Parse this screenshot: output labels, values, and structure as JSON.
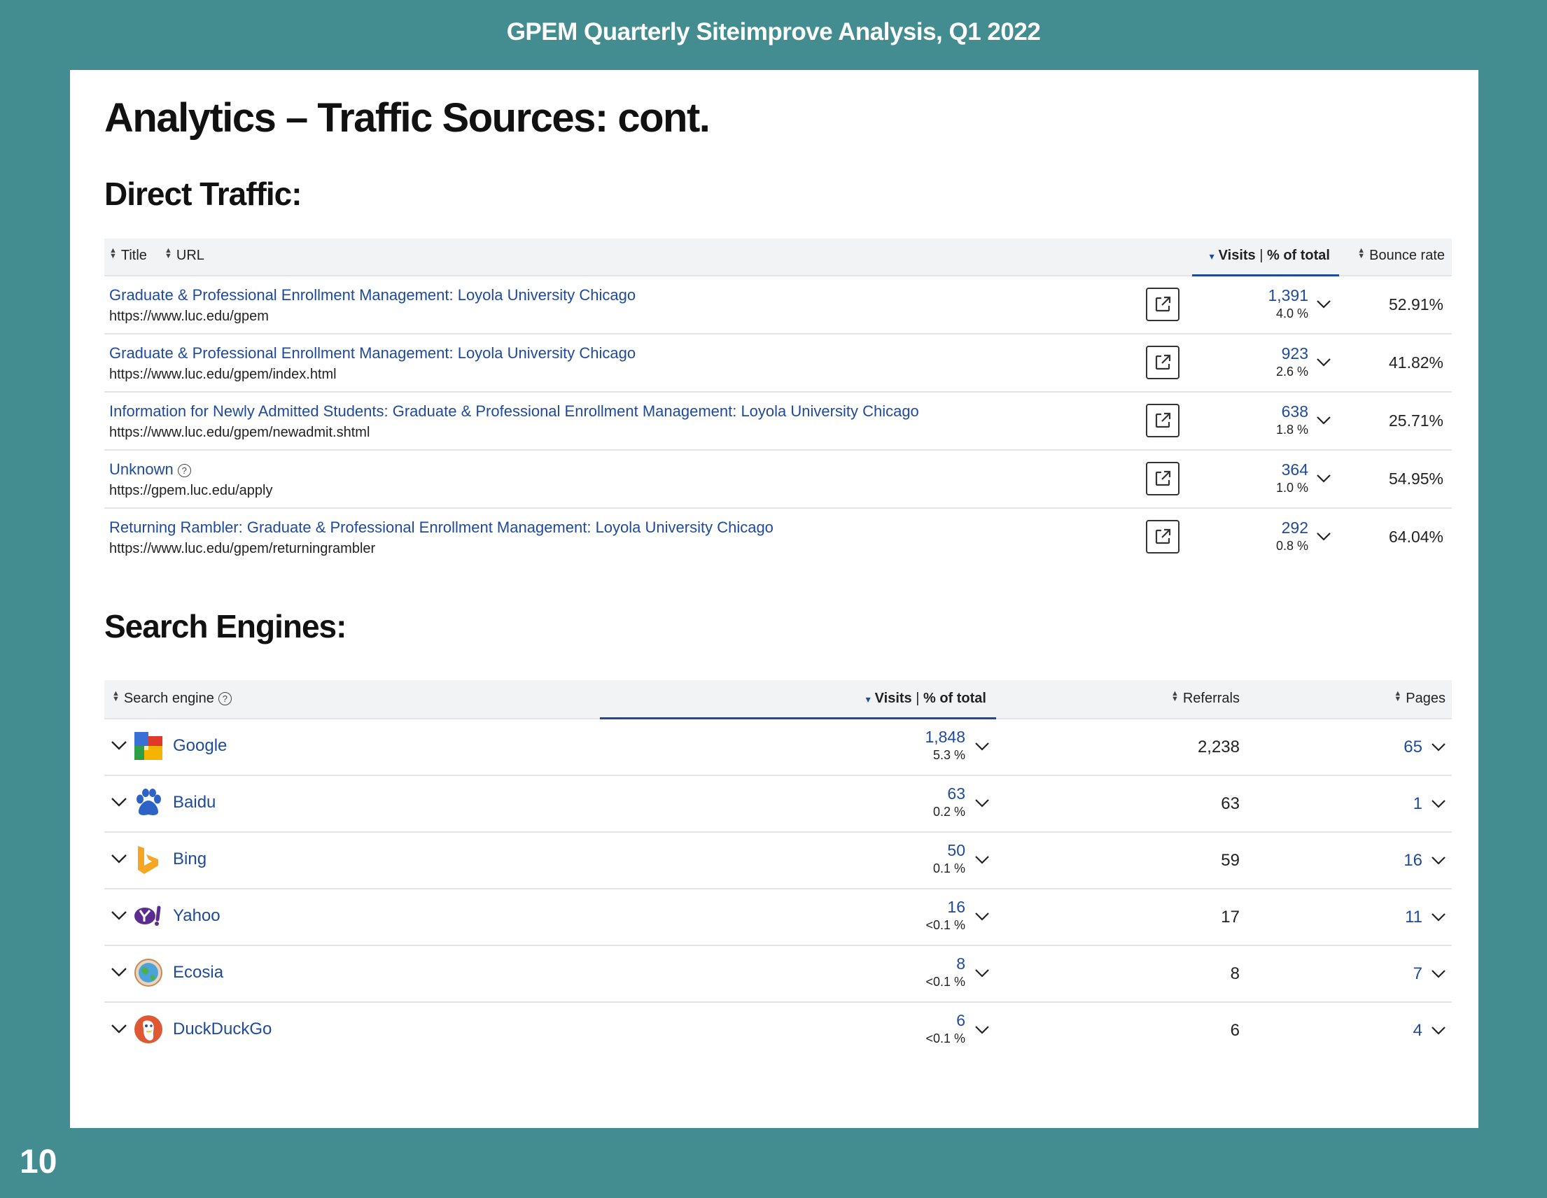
{
  "header": {
    "title": "GPEM Quarterly Siteimprove Analysis, Q1 2022"
  },
  "page": {
    "title": "Analytics – Traffic Sources: cont.",
    "number": "10"
  },
  "direct_traffic": {
    "heading": "Direct Traffic:",
    "columns": {
      "title": "Title",
      "url": "URL",
      "visits": "Visits",
      "separator": "|",
      "pct_total": "% of total",
      "bounce": "Bounce rate"
    },
    "rows": [
      {
        "title": "Graduate & Professional Enrollment Management: Loyola University Chicago",
        "url": "https://www.luc.edu/gpem",
        "visits": "1,391",
        "pct": "4.0 %",
        "bounce": "52.91%"
      },
      {
        "title": "Graduate & Professional Enrollment Management: Loyola University Chicago",
        "url": "https://www.luc.edu/gpem/index.html",
        "visits": "923",
        "pct": "2.6 %",
        "bounce": "41.82%"
      },
      {
        "title": "Information for Newly Admitted Students: Graduate & Professional Enrollment Management: Loyola University Chicago",
        "url": "https://www.luc.edu/gpem/newadmit.shtml",
        "visits": "638",
        "pct": "1.8 %",
        "bounce": "25.71%"
      },
      {
        "title": "Unknown",
        "url": "https://gpem.luc.edu/apply",
        "visits": "364",
        "pct": "1.0 %",
        "bounce": "54.95%"
      },
      {
        "title": "Returning Rambler: Graduate & Professional Enrollment Management: Loyola University Chicago",
        "url": "https://www.luc.edu/gpem/returningrambler",
        "visits": "292",
        "pct": "0.8 %",
        "bounce": "64.04%"
      }
    ]
  },
  "search_engines": {
    "heading": "Search Engines:",
    "columns": {
      "engine": "Search engine",
      "visits": "Visits",
      "separator": "|",
      "pct_total": "% of total",
      "referrals": "Referrals",
      "pages": "Pages"
    },
    "rows": [
      {
        "name": "Google",
        "icon": "google-logo-icon",
        "visits": "1,848",
        "pct": "5.3 %",
        "referrals": "2,238",
        "pages": "65"
      },
      {
        "name": "Baidu",
        "icon": "baidu-paw-icon",
        "visits": "63",
        "pct": "0.2 %",
        "referrals": "63",
        "pages": "1"
      },
      {
        "name": "Bing",
        "icon": "bing-logo-icon",
        "visits": "50",
        "pct": "0.1 %",
        "referrals": "59",
        "pages": "16"
      },
      {
        "name": "Yahoo",
        "icon": "yahoo-logo-icon",
        "visits": "16",
        "pct": "<0.1 %",
        "referrals": "17",
        "pages": "11"
      },
      {
        "name": "Ecosia",
        "icon": "ecosia-globe-icon",
        "visits": "8",
        "pct": "<0.1 %",
        "referrals": "8",
        "pages": "7"
      },
      {
        "name": "DuckDuckGo",
        "icon": "duckduckgo-logo-icon",
        "visits": "6",
        "pct": "<0.1 %",
        "referrals": "6",
        "pages": "4"
      }
    ]
  },
  "colors": {
    "background": "#438C8F",
    "link": "#1F4A9C",
    "header_row": "#F2F3F5"
  }
}
